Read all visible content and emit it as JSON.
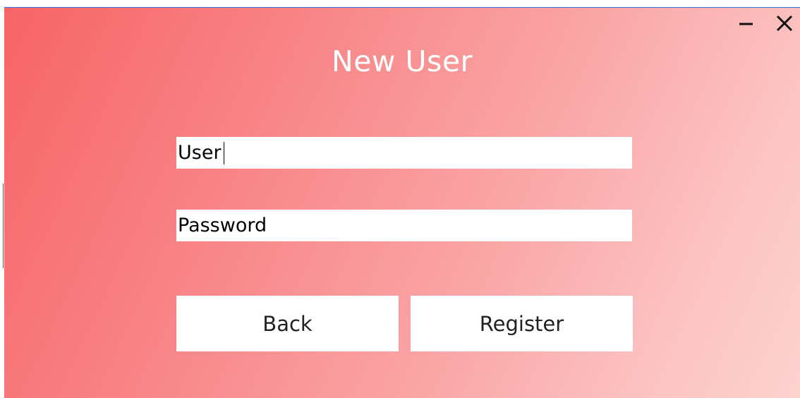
{
  "window": {
    "title": "New User",
    "controls": {
      "minimize_icon": "minimize-icon",
      "close_icon": "close-icon"
    }
  },
  "form": {
    "user_field": {
      "value": "User"
    },
    "password_field": {
      "value": "Password"
    }
  },
  "buttons": {
    "back_label": "Back",
    "register_label": "Register"
  },
  "colors": {
    "gradient_start": "#f76466",
    "gradient_end": "#fcd2cf",
    "field_background": "#ffffff",
    "title_text": "#ffffff"
  }
}
